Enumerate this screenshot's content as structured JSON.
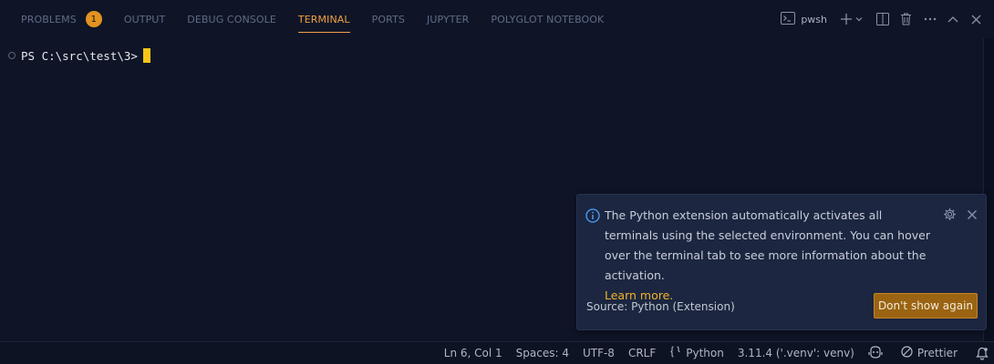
{
  "tabs": {
    "problems": "PROBLEMS",
    "problems_count": "1",
    "output": "OUTPUT",
    "debug_console": "DEBUG CONSOLE",
    "terminal": "TERMINAL",
    "ports": "PORTS",
    "jupyter": "JUPYTER",
    "polyglot": "POLYGLOT NOTEBOOK",
    "active": "TERMINAL"
  },
  "actions": {
    "terminal_kind": "pwsh",
    "icons": [
      "terminal-icon",
      "add-icon",
      "chevron-down-icon",
      "split-icon",
      "trash-icon",
      "more-icon",
      "maximize-icon",
      "close-icon"
    ]
  },
  "terminal": {
    "prompt": "PS C:\\src\\test\\3>"
  },
  "notification": {
    "message": "The Python extension automatically activates all terminals using the selected environment. You can hover over the terminal tab to see more information about the activation.",
    "link": "Learn more.",
    "source": "Source: Python (Extension)",
    "button": "Don't show again"
  },
  "status_bar": {
    "position": "Ln 6, Col 1",
    "spaces": "Spaces: 4",
    "encoding": "UTF-8",
    "eol": "CRLF",
    "language": "Python",
    "interpreter": "3.11.4 ('.venv': venv)",
    "prettier": "Prettier"
  },
  "colors": {
    "background": "#0f1527",
    "accent": "#f0a043",
    "badge": "#e39320",
    "cursor": "#f5c518",
    "link": "#f0b429",
    "button": "#9a6412"
  }
}
